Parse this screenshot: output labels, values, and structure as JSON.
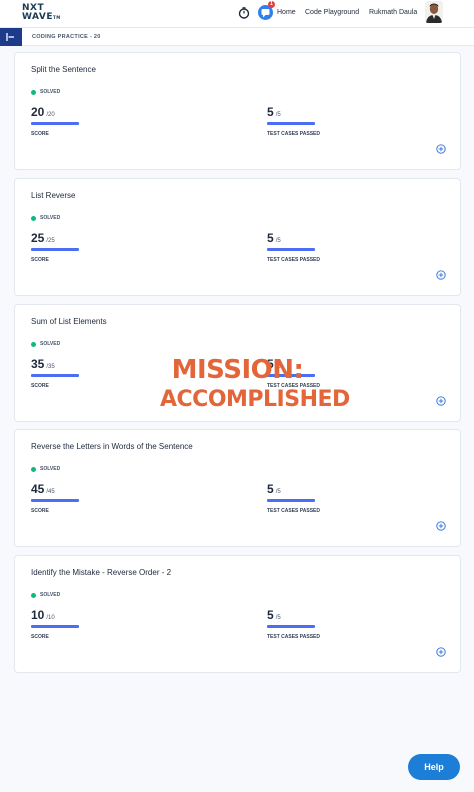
{
  "header": {
    "logo_line1": "NXT",
    "logo_line2": "WAVE",
    "logo_tm": "TM",
    "notification_count": "1",
    "nav_home": "Home",
    "nav_code_playground": "Code Playground",
    "user_name": "Rukmath Daula"
  },
  "breadcrumb": "CODING PRACTICE - 20",
  "cards": [
    {
      "title": "Split the Sentence",
      "status": "SOLVED",
      "score": "20",
      "score_total": "/20",
      "score_label": "SCORE",
      "tests": "5",
      "tests_total": "/5",
      "tests_label": "TEST CASES PASSED"
    },
    {
      "title": "List Reverse",
      "status": "SOLVED",
      "score": "25",
      "score_total": "/25",
      "score_label": "SCORE",
      "tests": "5",
      "tests_total": "/5",
      "tests_label": "TEST CASES PASSED"
    },
    {
      "title": "Sum of List Elements",
      "status": "SOLVED",
      "score": "35",
      "score_total": "/35",
      "score_label": "SCORE",
      "tests": "5",
      "tests_total": "/5",
      "tests_label": "TEST CASES PASSED"
    },
    {
      "title": "Reverse the Letters in Words of the Sentence",
      "status": "SOLVED",
      "score": "45",
      "score_total": "/45",
      "score_label": "SCORE",
      "tests": "5",
      "tests_total": "/5",
      "tests_label": "TEST CASES PASSED"
    },
    {
      "title": "Identify the Mistake - Reverse Order - 2",
      "status": "SOLVED",
      "score": "10",
      "score_total": "/10",
      "score_label": "SCORE",
      "tests": "5",
      "tests_total": "/5",
      "tests_label": "TEST CASES PASSED"
    }
  ],
  "sticker": {
    "line1": "MISSION:",
    "line2": "ACCOMPLISHED"
  },
  "help_label": "Help",
  "colors": {
    "accent": "#1c7ed6",
    "solved": "#10b981",
    "bar": "#4c6ef5",
    "sticker": "#e2663a",
    "sidebar": "#1e3a8a"
  }
}
